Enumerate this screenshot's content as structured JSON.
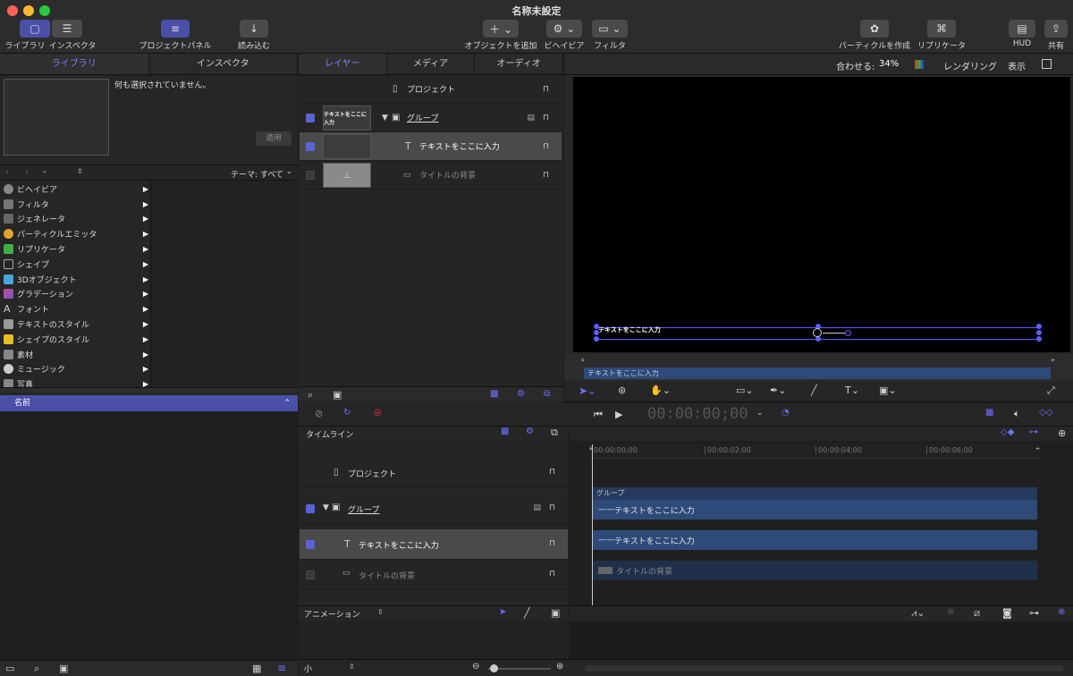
{
  "window": {
    "title": "名称未設定"
  },
  "toolbar": {
    "library": "ライブラリ",
    "inspector": "インスペクタ",
    "project_panel": "プロジェクトパネル",
    "import": "読み込む",
    "add_object": "オブジェクトを追加",
    "behaviors": "ビヘイビア",
    "filters": "フィルタ",
    "make_particles": "パーティクルを作成",
    "replicate": "リプリケータ",
    "hud": "HUD",
    "share": "共有"
  },
  "left_tabs": [
    "ライブラリ",
    "インスペクタ"
  ],
  "library": {
    "none_selected": "何も選択されていません。",
    "apply": "適用",
    "path_value": "-",
    "theme": "テーマ: すべて",
    "categories": [
      "ビヘイビア",
      "フィルタ",
      "ジェネレータ",
      "パーティクルエミッタ",
      "リプリケータ",
      "シェイプ",
      "3Dオブジェクト",
      "グラデーション",
      "フォント",
      "テキストのスタイル",
      "シェイプのスタイル",
      "素材",
      "ミュージック",
      "写真"
    ],
    "name_header": "名前"
  },
  "center_tabs": [
    "レイヤー",
    "メディア",
    "オーディオ"
  ],
  "layers": {
    "project": "プロジェクト",
    "group": "グループ",
    "text": "テキストをここに入力",
    "thumb_text": "テキストをここに入力",
    "bg": "タイトルの背景"
  },
  "canvas": {
    "fit_label": "合わせる:",
    "fit_value": "34%",
    "render": "レンダリング",
    "view": "表示",
    "overlay_text": "テキストをここに入力",
    "mini_bar_label": "テキストをここに入力"
  },
  "transport": {
    "timecode": "00:00:00;00"
  },
  "timeline": {
    "label": "タイムライン",
    "ruler": [
      "00:00:00;00",
      "00:00:02;00",
      "00:00:04;00",
      "00:00:06;00"
    ],
    "project": "プロジェクト",
    "group": "グループ",
    "text": "テキストをここに入力",
    "bg": "タイトルの背景",
    "group_bar": "グループ",
    "text_bar1": "テキストをここに入力",
    "text_bar2": "テキストをここに入力",
    "bg_bar": "タイトルの背景"
  },
  "animation": {
    "label": "アニメーション"
  },
  "bottom": {
    "size": "小"
  },
  "colors": {
    "accent": "#6a72ff",
    "selected_blue": "#4a4fa8",
    "bar_blue": "#2e4a78"
  }
}
